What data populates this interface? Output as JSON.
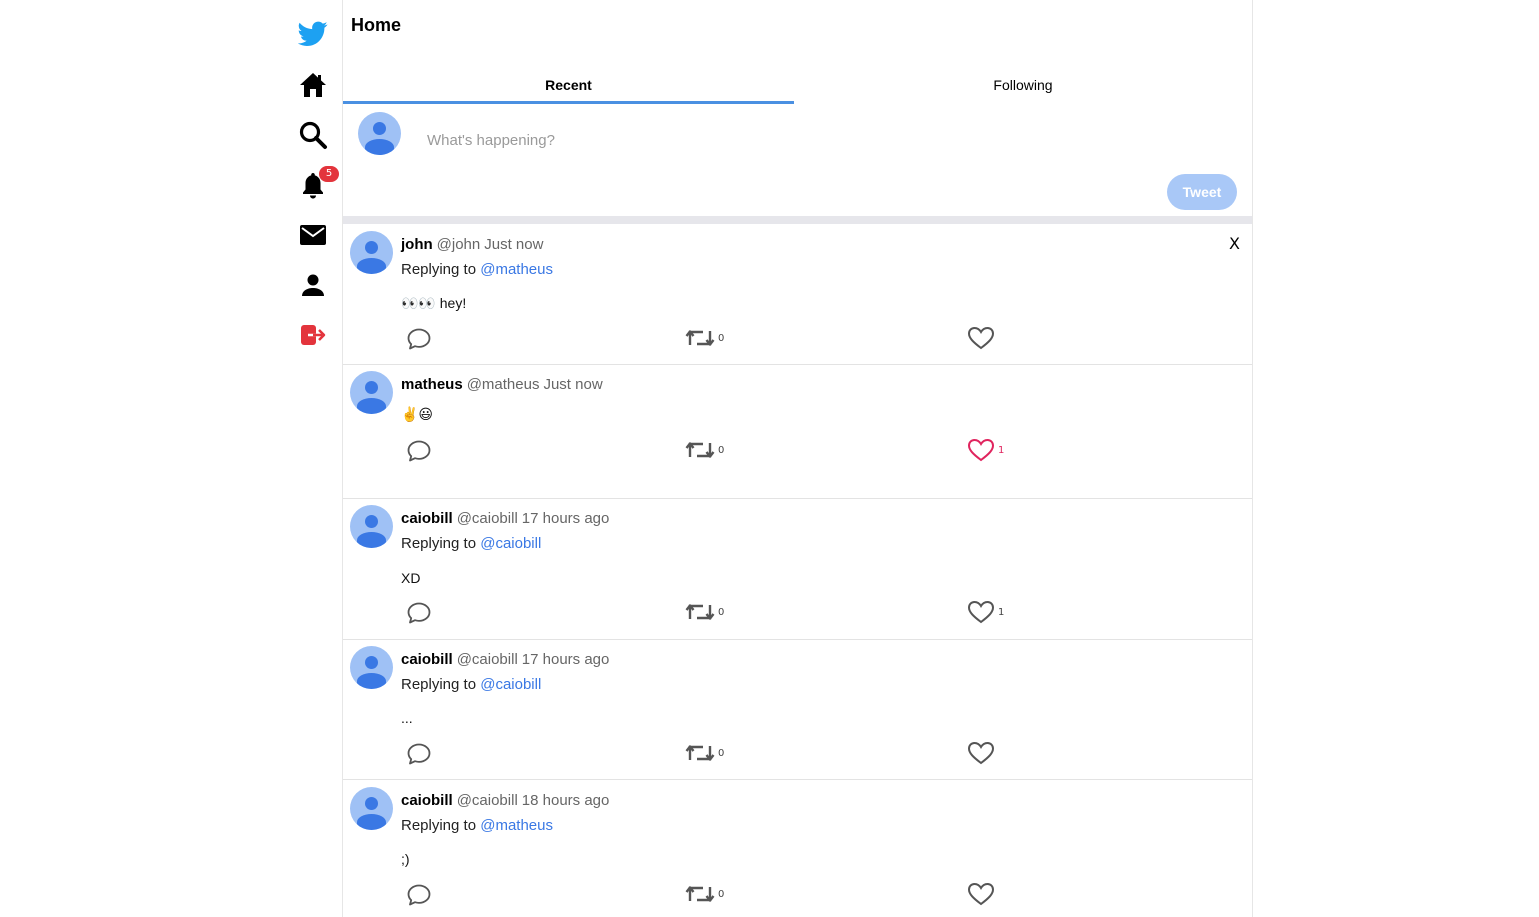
{
  "nav": {
    "notification_badge": "5"
  },
  "header": {
    "title": "Home"
  },
  "tabs": [
    {
      "label": "Recent"
    },
    {
      "label": "Following"
    }
  ],
  "compose": {
    "placeholder": "What's happening?",
    "tweet_label": "Tweet"
  },
  "reply_prefix": "Replying to",
  "tweets": [
    {
      "name": "john",
      "handle": "@john",
      "time": "Just now",
      "reply_to": "@matheus",
      "text": "👀👀 hey!",
      "retweets": "0",
      "likes": "",
      "liked": false,
      "close": "X"
    },
    {
      "name": "matheus",
      "handle": "@matheus",
      "time": "Just now",
      "reply_to": "",
      "text": "✌️😃",
      "retweets": "0",
      "likes": "1",
      "liked": true
    },
    {
      "name": "caiobill",
      "handle": "@caiobill",
      "time": "17 hours ago",
      "reply_to": "@caiobill",
      "text": "XD",
      "retweets": "0",
      "likes": "1",
      "liked": false
    },
    {
      "name": "caiobill",
      "handle": "@caiobill",
      "time": "17 hours ago",
      "reply_to": "@caiobill",
      "text": "...",
      "retweets": "0",
      "likes": "",
      "liked": false
    },
    {
      "name": "caiobill",
      "handle": "@caiobill",
      "time": "18 hours ago",
      "reply_to": "@matheus",
      "text": ";)",
      "retweets": "0",
      "likes": "",
      "liked": false
    }
  ],
  "colors": {
    "accent": "#1da1f2",
    "link": "#3a78e4",
    "like_active": "#e0245e",
    "logout": "#e0245e"
  }
}
